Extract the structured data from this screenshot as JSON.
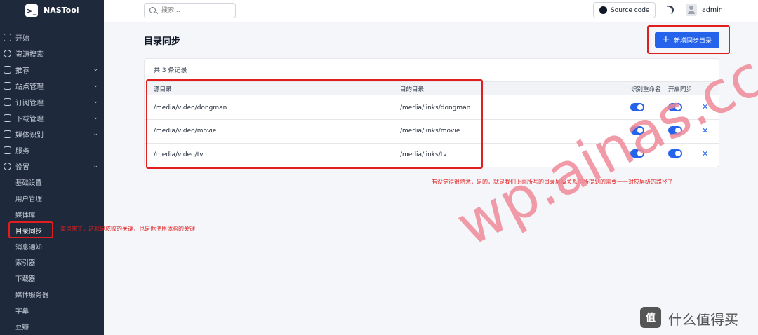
{
  "app": {
    "name": "NASTool",
    "logo_glyph": ">_"
  },
  "header": {
    "search_placeholder": "搜索...",
    "source_button": "Source code",
    "user": "admin"
  },
  "sidebar": {
    "items": [
      {
        "label": "开始",
        "icon": "home-icon"
      },
      {
        "label": "资源搜索",
        "icon": "search-icon"
      },
      {
        "label": "推荐",
        "icon": "star-icon",
        "chevron": "⌄"
      },
      {
        "label": "站点管理",
        "icon": "check-square-icon",
        "chevron": "⌄"
      },
      {
        "label": "订阅管理",
        "icon": "check-square-icon",
        "chevron": "⌄"
      },
      {
        "label": "下载管理",
        "icon": "download-icon",
        "chevron": "⌄"
      },
      {
        "label": "媒体识别",
        "icon": "film-icon",
        "chevron": "⌄"
      },
      {
        "label": "服务",
        "icon": "grid-icon"
      },
      {
        "label": "设置",
        "icon": "gear-icon",
        "chevron": "⌄"
      }
    ],
    "subitems": [
      "基础设置",
      "用户管理",
      "媒体库",
      "目录同步",
      "消息通知",
      "索引器",
      "下载器",
      "媒体服务器",
      "字幕",
      "豆瓣"
    ]
  },
  "main": {
    "title": "目录同步",
    "add_button": "新增同步目录",
    "count_text": "共 3 条记录",
    "columns": [
      "源目录",
      "目的目录",
      "识别重命名",
      "开启同步"
    ],
    "rows": [
      {
        "source": "/media/video/dongman",
        "dest": "/media/links/dongman",
        "rename": true,
        "sync": true
      },
      {
        "source": "/media/video/movie",
        "dest": "/media/links/movie",
        "rename": true,
        "sync": true
      },
      {
        "source": "/media/video/tv",
        "dest": "/media/links/tv",
        "rename": true,
        "sync": true
      }
    ]
  },
  "annotations": {
    "note_table": "有没觉得很熟悉，是的，就是我们上面所写的目录层级关系中所提到的需要一一对应层级的路径了",
    "note_sidebar": "重点来了，这就是成败的关键，也是你使用体验的关键"
  },
  "watermark": "wp.ainas.cc",
  "corner": {
    "logo_text": "值",
    "text": "什么值得买"
  },
  "colors": {
    "accent": "#2563eb",
    "sidebar_bg": "#1e293b",
    "annotation": "#e11d1d"
  }
}
